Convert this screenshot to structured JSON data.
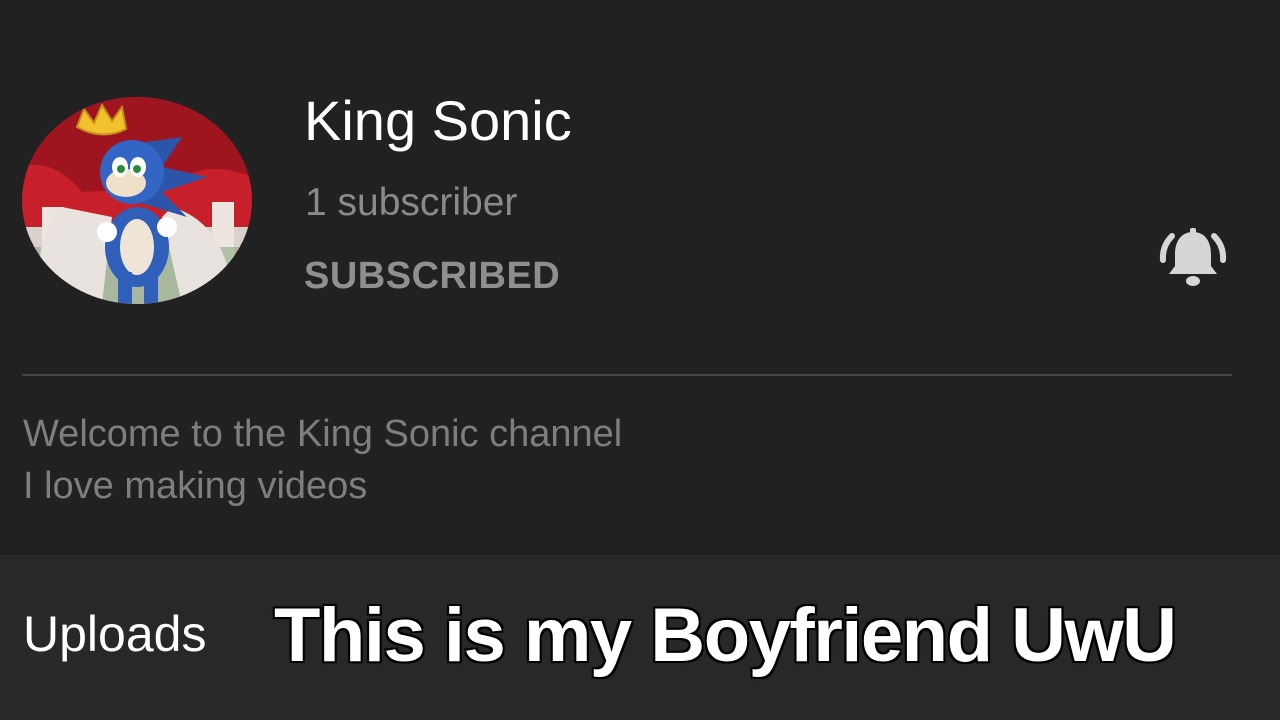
{
  "channel": {
    "name": "King Sonic",
    "subscriber_count": "1 subscriber",
    "subscribe_state_label": "SUBSCRIBED",
    "description_lines": [
      "Welcome to the King Sonic channel",
      "I love making videos"
    ]
  },
  "icons": {
    "notification": "bell-ringing-icon",
    "avatar": "channel-avatar-image"
  },
  "tabs": {
    "uploads_label": "Uploads"
  },
  "overlay_caption": "This is my Boyfriend UwU",
  "colors": {
    "background": "#212121",
    "bottom_band": "#282828",
    "title_text": "#ffffff",
    "secondary_text": "#8a8a8a",
    "divider": "#454545",
    "avatar_red": "#c8202a",
    "sonic_blue": "#2f5fb8",
    "crown_gold": "#f2c12e"
  }
}
